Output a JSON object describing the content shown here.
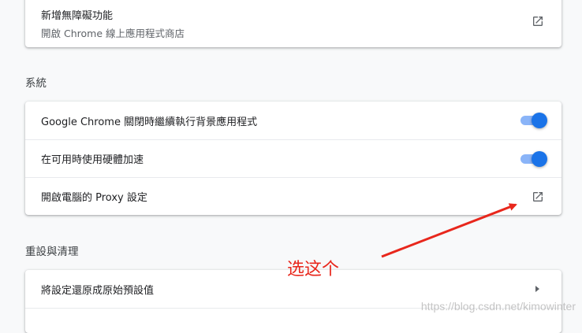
{
  "top_card": {
    "title": "新增無障礙功能",
    "subtitle": "開啟 Chrome 線上應用程式商店",
    "icon": "open-in-new-icon"
  },
  "system": {
    "section_title": "系統",
    "items": [
      {
        "label": "Google Chrome 關閉時繼續執行背景應用程式",
        "control": "toggle",
        "state": "on"
      },
      {
        "label": "在可用時使用硬體加速",
        "control": "toggle",
        "state": "on"
      },
      {
        "label": "開啟電腦的 Proxy 設定",
        "control": "open-in-new-icon"
      }
    ]
  },
  "reset": {
    "section_title": "重設與清理",
    "items": [
      {
        "label": "將設定還原成原始預設值",
        "control": "chevron-right-icon"
      }
    ]
  },
  "annotation": {
    "text": "选这个",
    "color": "#e8271c"
  },
  "watermark": "https://blog.csdn.net/kimowinter",
  "colors": {
    "toggle_knob": "#1a73e8",
    "toggle_track": "#8ab4f8",
    "background": "#f8f9fa"
  }
}
